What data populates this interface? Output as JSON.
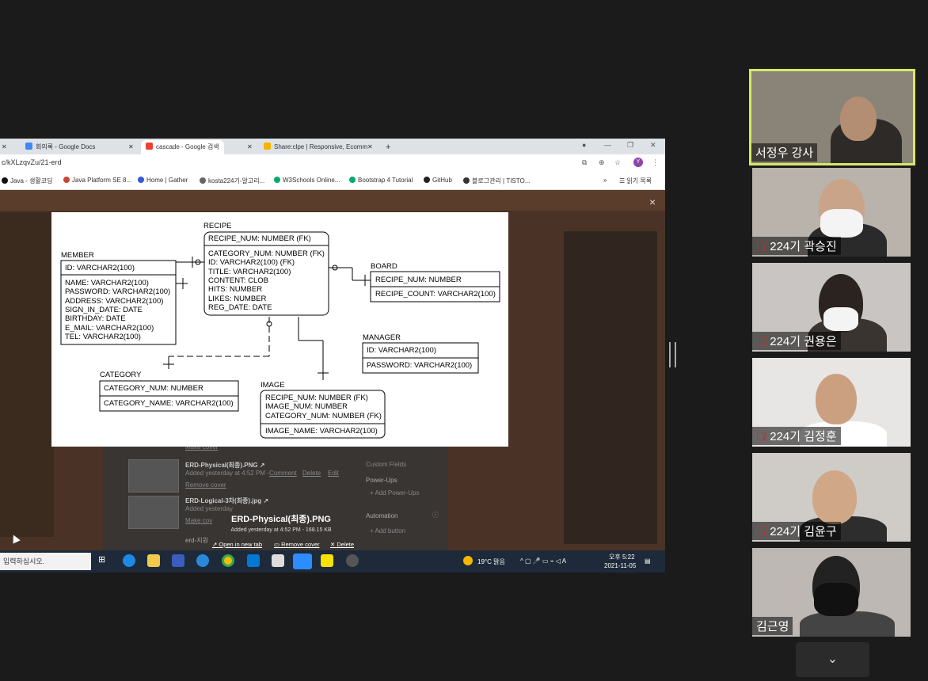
{
  "browser": {
    "tabs": [
      {
        "title": "회의록 - Google Docs",
        "color": "#4285f4"
      },
      {
        "title": "cascade - Google 검색",
        "color": "#ea4335"
      },
      {
        "title": "Share:clpe | Responsive, Ecomm",
        "color": "#f4b400"
      }
    ],
    "new_tab": "+",
    "url": "c/kXLzqvZu/21-erd",
    "bookmarks": [
      {
        "label": "Java - 생활코딩",
        "color": "#111111"
      },
      {
        "label": "Java Platform SE 8...",
        "color": "#c74634"
      },
      {
        "label": "Home | Gather",
        "color": "#3557d9"
      },
      {
        "label": "kosta224기-알고리...",
        "color": "#666666"
      },
      {
        "label": "W3Schools Online...",
        "color": "#04aa6d"
      },
      {
        "label": "Bootstrap 4 Tutorial",
        "color": "#04aa6d"
      },
      {
        "label": "GitHub",
        "color": "#222222"
      },
      {
        "label": "블로그관리 | TISTO...",
        "color": "#333333"
      }
    ],
    "reading_list": "읽기 목록",
    "profile_initial": "Y"
  },
  "erd": {
    "member": {
      "title": "MEMBER",
      "pk": "ID: VARCHAR2(100)",
      "cols": [
        "NAME: VARCHAR2(100)",
        "PASSWORD: VARCHAR2(100)",
        "ADDRESS: VARCHAR2(100)",
        "SIGN_IN_DATE: DATE",
        "BIRTHDAY: DATE",
        "E_MAIL: VARCHAR2(100)",
        "TEL: VARCHAR2(100)"
      ]
    },
    "recipe": {
      "title": "RECIPE",
      "pk": "RECIPE_NUM: NUMBER (FK)",
      "cols": [
        "CATEGORY_NUM: NUMBER (FK)",
        "ID: VARCHAR2(100) (FK)",
        "TITLE: VARCHAR2(100)",
        "CONTENT: CLOB",
        "HITS: NUMBER",
        "LIKES: NUMBER",
        "REG_DATE: DATE"
      ]
    },
    "board": {
      "title": "BOARD",
      "pk": "RECIPE_NUM: NUMBER",
      "cols": [
        "RECIPE_COUNT: VARCHAR2(100)"
      ]
    },
    "manager": {
      "title": "MANAGER",
      "pk": "ID: VARCHAR2(100)",
      "cols": [
        "PASSWORD: VARCHAR2(100)"
      ]
    },
    "category": {
      "title": "CATEGORY",
      "pk": "CATEGORY_NUM: NUMBER",
      "cols": [
        "CATEGORY_NAME: VARCHAR2(100)"
      ]
    },
    "image": {
      "title": "IMAGE",
      "pk": "RECIPE_NUM: NUMBER (FK)",
      "pk2": "IMAGE_NUM: NUMBER",
      "pk3": "CATEGORY_NUM: NUMBER (FK)",
      "cols": [
        "IMAGE_NAME: VARCHAR2(100)"
      ]
    }
  },
  "trello": {
    "attachments": [
      {
        "name": "ERD-Physical(최종).PNG ↗",
        "meta": "Added yesterday at 4:52 PM -",
        "actions": [
          "Comment",
          "Delete",
          "Edit"
        ],
        "remove": "Remove cover"
      },
      {
        "name": "ERD-Logical-3차(최종).jpg ↗",
        "meta": "Added yesterday",
        "actions": [],
        "remove": "Make cov"
      }
    ],
    "side": {
      "custom_fields": "Custom Fields",
      "power_ups": "Power-Ups",
      "add_power_ups": "+ Add Power-Ups",
      "automation": "Automation",
      "add_button": "+ Add button"
    },
    "first_make_cover": "Make cover",
    "erd_short": "erd-지원"
  },
  "viewer": {
    "title": "ERD-Physical(최종).PNG",
    "subtitle": "Added yesterday at 4:52 PM - 168.15 KB",
    "open_new_tab": "Open in new tab",
    "remove_cover": "Remove cover",
    "delete": "Delete",
    "close": "×"
  },
  "taskbar": {
    "search_placeholder": "입력하십시오.",
    "weather": "19°C  맑음",
    "time": "오후 5:22",
    "date": "2021-11-05",
    "ime": "A"
  },
  "participants": [
    {
      "name": "서정우 강사",
      "muted": false
    },
    {
      "name": "224기 곽승진",
      "muted": true
    },
    {
      "name": "224기 권용은",
      "muted": true
    },
    {
      "name": "224기 김정훈",
      "muted": true
    },
    {
      "name": "224기 김윤구",
      "muted": true
    },
    {
      "name": "김근영",
      "muted": false
    }
  ],
  "colors": {
    "speaker_border": "#d8e863",
    "muted_icon": "#e02020",
    "tile_bg": "#5a5a5a"
  }
}
